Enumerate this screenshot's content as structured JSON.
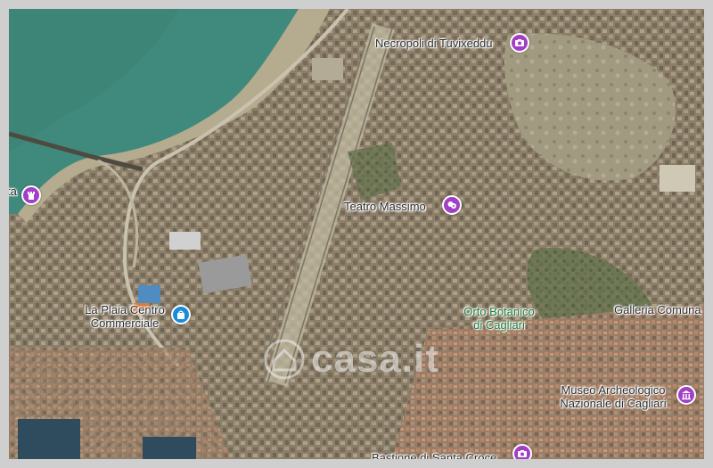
{
  "map": {
    "type": "satellite",
    "watermark": "casa.it",
    "labels": {
      "necropoli": "Necropoli di Tuvixeddu",
      "teatro": "Teatro Massimo",
      "plaia_line1": "La Plaia Centro",
      "plaia_line2": "Commerciale",
      "orto_line1": "Orto Botanico",
      "orto_line2": "di Cagliari",
      "galleria": "Galleria Comuna",
      "museo_line1": "Museo Archeologico",
      "museo_line2": "Nazionale di Cagliari",
      "bastione": "Bastione di Santa Croce",
      "left_cut": "ta"
    },
    "pois": [
      {
        "name": "necropoli-poi",
        "icon": "camera-icon",
        "color": "#a33fc4"
      },
      {
        "name": "teatro-poi",
        "icon": "theater-icon",
        "color": "#a33fc4"
      },
      {
        "name": "plaia-poi",
        "icon": "shopping-bag-icon",
        "color": "#1a8cd8"
      },
      {
        "name": "museo-poi",
        "icon": "museum-icon",
        "color": "#a33fc4"
      },
      {
        "name": "left-poi",
        "icon": "tower-icon",
        "color": "#a33fc4"
      },
      {
        "name": "bastione-poi",
        "icon": "camera-icon",
        "color": "#a33fc4"
      }
    ]
  }
}
